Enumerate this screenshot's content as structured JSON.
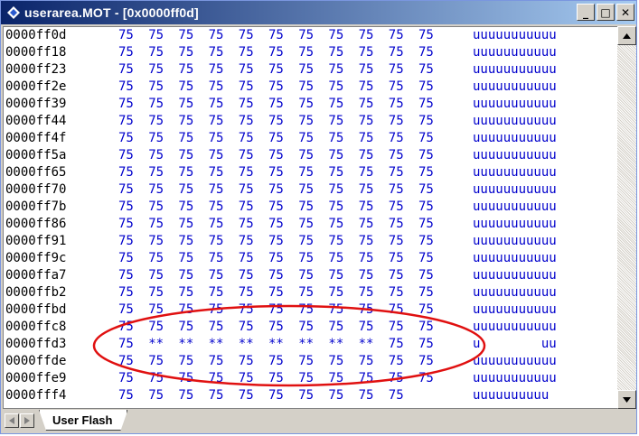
{
  "window": {
    "title": "userarea.MOT - [0x0000ff0d]"
  },
  "title_buttons": {
    "minimize": "_",
    "maximize": "□",
    "close": "✕"
  },
  "rows": [
    {
      "addr": "0000ff0d",
      "bytes": "75 75 75 75 75 75 75 75 75 75 75",
      "ascii": "uuuuuuuuuuu"
    },
    {
      "addr": "0000ff18",
      "bytes": "75 75 75 75 75 75 75 75 75 75 75",
      "ascii": "uuuuuuuuuuu"
    },
    {
      "addr": "0000ff23",
      "bytes": "75 75 75 75 75 75 75 75 75 75 75",
      "ascii": "uuuuuuuuuuu"
    },
    {
      "addr": "0000ff2e",
      "bytes": "75 75 75 75 75 75 75 75 75 75 75",
      "ascii": "uuuuuuuuuuu"
    },
    {
      "addr": "0000ff39",
      "bytes": "75 75 75 75 75 75 75 75 75 75 75",
      "ascii": "uuuuuuuuuuu"
    },
    {
      "addr": "0000ff44",
      "bytes": "75 75 75 75 75 75 75 75 75 75 75",
      "ascii": "uuuuuuuuuuu"
    },
    {
      "addr": "0000ff4f",
      "bytes": "75 75 75 75 75 75 75 75 75 75 75",
      "ascii": "uuuuuuuuuuu"
    },
    {
      "addr": "0000ff5a",
      "bytes": "75 75 75 75 75 75 75 75 75 75 75",
      "ascii": "uuuuuuuuuuu"
    },
    {
      "addr": "0000ff65",
      "bytes": "75 75 75 75 75 75 75 75 75 75 75",
      "ascii": "uuuuuuuuuuu"
    },
    {
      "addr": "0000ff70",
      "bytes": "75 75 75 75 75 75 75 75 75 75 75",
      "ascii": "uuuuuuuuuuu"
    },
    {
      "addr": "0000ff7b",
      "bytes": "75 75 75 75 75 75 75 75 75 75 75",
      "ascii": "uuuuuuuuuuu"
    },
    {
      "addr": "0000ff86",
      "bytes": "75 75 75 75 75 75 75 75 75 75 75",
      "ascii": "uuuuuuuuuuu"
    },
    {
      "addr": "0000ff91",
      "bytes": "75 75 75 75 75 75 75 75 75 75 75",
      "ascii": "uuuuuuuuuuu"
    },
    {
      "addr": "0000ff9c",
      "bytes": "75 75 75 75 75 75 75 75 75 75 75",
      "ascii": "uuuuuuuuuuu"
    },
    {
      "addr": "0000ffa7",
      "bytes": "75 75 75 75 75 75 75 75 75 75 75",
      "ascii": "uuuuuuuuuuu"
    },
    {
      "addr": "0000ffb2",
      "bytes": "75 75 75 75 75 75 75 75 75 75 75",
      "ascii": "uuuuuuuuuuu"
    },
    {
      "addr": "0000ffbd",
      "bytes": "75 75 75 75 75 75 75 75 75 75 75",
      "ascii": "uuuuuuuuuuu"
    },
    {
      "addr": "0000ffc8",
      "bytes": "75 75 75 75 75 75 75 75 75 75 75",
      "ascii": "uuuuuuuuuuu"
    },
    {
      "addr": "0000ffd3",
      "bytes": "75 ** ** ** ** ** ** ** ** 75 75",
      "ascii": "u        uu"
    },
    {
      "addr": "0000ffde",
      "bytes": "75 75 75 75 75 75 75 75 75 75 75",
      "ascii": "uuuuuuuuuuu"
    },
    {
      "addr": "0000ffe9",
      "bytes": "75 75 75 75 75 75 75 75 75 75 75",
      "ascii": "uuuuuuuuuuu"
    },
    {
      "addr": "0000fff4",
      "bytes": "75 75 75 75 75 75 75 75 75 75",
      "ascii": "uuuuuuuuuu"
    }
  ],
  "tabs": {
    "active": "User Flash"
  },
  "colors": {
    "bytes": "#0000cc",
    "annotation": "#e01010"
  }
}
